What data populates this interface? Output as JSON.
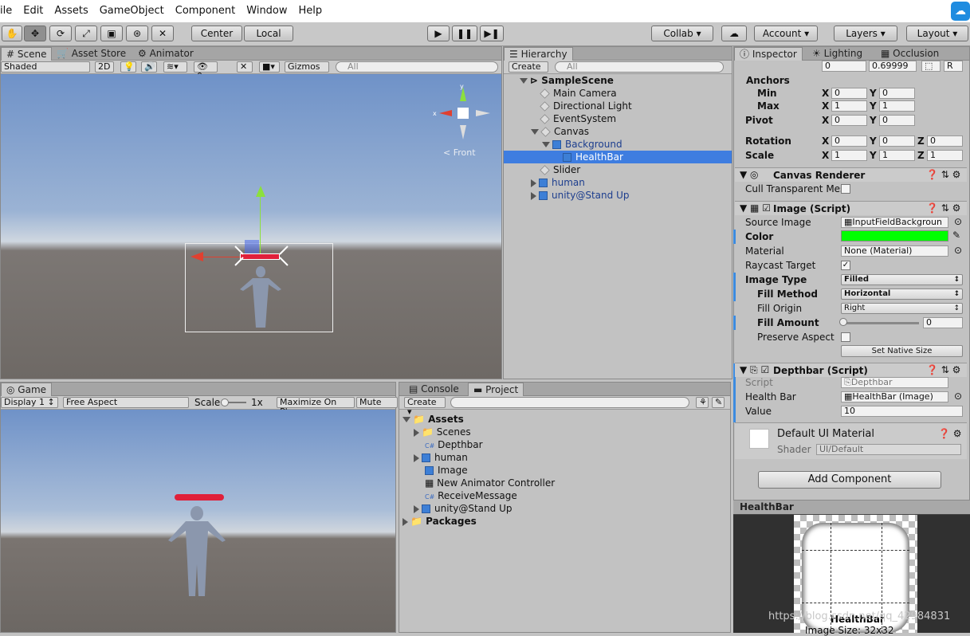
{
  "menu": [
    "ile",
    "Edit",
    "Assets",
    "GameObject",
    "Component",
    "Window",
    "Help"
  ],
  "toolbar": {
    "center": "Center",
    "local": "Local",
    "collab": "Collab ▾",
    "account": "Account",
    "layers": "Layers",
    "layout": "Layout"
  },
  "scene": {
    "tabs": [
      "Scene",
      "Asset Store",
      "Animator"
    ],
    "shading": "Shaded",
    "mode2d": "2D",
    "count": "0",
    "gizmos": "Gizmos",
    "search": "All",
    "front": "< Front"
  },
  "hierarchy": {
    "tab": "Hierarchy",
    "create": "Create",
    "search": "All",
    "scene": "SampleScene",
    "items": [
      "Main Camera",
      "Directional Light",
      "EventSystem",
      "Canvas",
      "Background",
      "HealthBar",
      "Slider",
      "human",
      "unity@Stand Up"
    ]
  },
  "inspector": {
    "tabs": [
      "Inspector",
      "Lighting",
      "Occlusion"
    ],
    "top_values": [
      "0",
      "0.69999"
    ],
    "anchors": "Anchors",
    "min": "Min",
    "max": "Max",
    "pivot": "Pivot",
    "rotation": "Rotation",
    "scale": "Scale",
    "min_x": "0",
    "min_y": "0",
    "max_x": "1",
    "max_y": "1",
    "pivot_x": "0",
    "pivot_y": "0",
    "rot_x": "0",
    "rot_y": "0",
    "rot_z": "0",
    "scale_x": "1",
    "scale_y": "1",
    "scale_z": "1",
    "canvas_renderer": "Canvas Renderer",
    "cull": "Cull Transparent Mes",
    "image_script": "Image (Script)",
    "source_image": "Source Image",
    "source_val": "InputFieldBackgroun",
    "color": "Color",
    "color_hex": "#00ff00",
    "material": "Material",
    "material_val": "None (Material)",
    "raycast": "Raycast Target",
    "image_type": "Image Type",
    "image_type_val": "Filled",
    "fill_method": "Fill Method",
    "fill_method_val": "Horizontal",
    "fill_origin": "Fill Origin",
    "fill_origin_val": "Right",
    "fill_amount": "Fill Amount",
    "fill_amount_val": "0",
    "preserve": "Preserve Aspect",
    "native": "Set Native Size",
    "depthbar": "Depthbar (Script)",
    "script": "Script",
    "script_val": "Depthbar",
    "health_bar": "Health Bar",
    "health_val": "HealthBar (Image)",
    "value": "Value",
    "value_val": "10",
    "default_mat": "Default UI Material",
    "shader": "Shader",
    "shader_val": "UI/Default",
    "add_component": "Add Component"
  },
  "game": {
    "tab": "Game",
    "display": "Display 1",
    "aspect": "Free Aspect",
    "scale": "Scale",
    "scale_val": "1x",
    "maximize": "Maximize On Play",
    "mute": "Mute Aud"
  },
  "project": {
    "tabs": [
      "Console",
      "Project"
    ],
    "create": "Create",
    "assets": "Assets",
    "items": [
      "Scenes",
      "Depthbar",
      "human",
      "Image",
      "New Animator Controller",
      "ReceiveMessage",
      "unity@Stand Up"
    ],
    "packages": "Packages"
  },
  "preview": {
    "title": "HealthBar",
    "caption": "HealthBar",
    "size": "Image Size: 32x32",
    "watermark": "https://blog.csdn.net/qq_42984831"
  }
}
